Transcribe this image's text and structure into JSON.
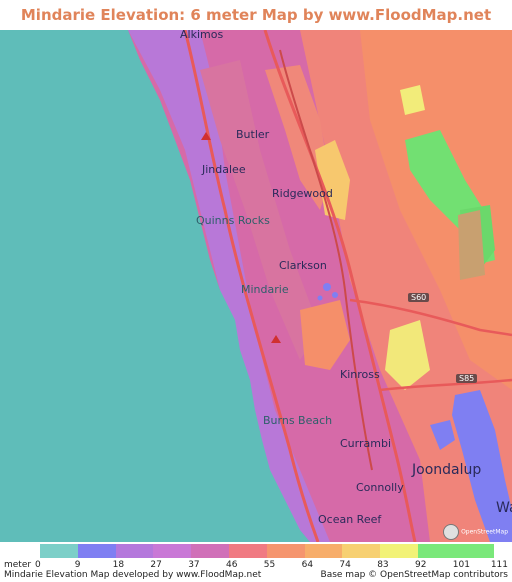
{
  "title": "Mindarie Elevation: 6 meter Map by www.FloodMap.net (beta)",
  "map": {
    "place_labels": [
      {
        "id": "alkimos",
        "text": "Alkimos"
      },
      {
        "id": "butler",
        "text": "Butler"
      },
      {
        "id": "jindalee",
        "text": "Jindalee"
      },
      {
        "id": "ridgewood",
        "text": "Ridgewood"
      },
      {
        "id": "quinns-rocks",
        "text": "Quinns Rocks"
      },
      {
        "id": "clarkson",
        "text": "Clarkson"
      },
      {
        "id": "mindarie",
        "text": "Mindarie"
      },
      {
        "id": "kinross",
        "text": "Kinross"
      },
      {
        "id": "burns-beach",
        "text": "Burns Beach"
      },
      {
        "id": "currambi",
        "text": "Currambi"
      },
      {
        "id": "joondalup",
        "text": "Joondalup"
      },
      {
        "id": "connolly",
        "text": "Connolly"
      },
      {
        "id": "ocean-reef",
        "text": "Ocean Reef"
      },
      {
        "id": "wa",
        "text": "Wa"
      }
    ],
    "road_labels": [
      {
        "id": "s60",
        "text": "S60"
      },
      {
        "id": "s85",
        "text": "S85"
      }
    ],
    "osm_logo_text": "OpenStreetMap"
  },
  "legend": {
    "unit": "meter",
    "ticks": [
      "0",
      "9",
      "18",
      "27",
      "37",
      "46",
      "55",
      "64",
      "74",
      "83",
      "92",
      "101",
      "111"
    ],
    "colors": [
      "#7ccfc8",
      "#7f7ff2",
      "#b478dc",
      "#c978d6",
      "#d070b8",
      "#f07a82",
      "#f5956e",
      "#f7ad6a",
      "#f7d072",
      "#f2f277",
      "#7ae87a",
      "#7ae87a"
    ]
  },
  "credits": {
    "left": "Mindarie Elevation Map developed by www.FloodMap.net",
    "right": "Base map © OpenStreetMap contributors"
  },
  "colors": {
    "sea": "#5fbdb9",
    "title": "#e0845a"
  }
}
